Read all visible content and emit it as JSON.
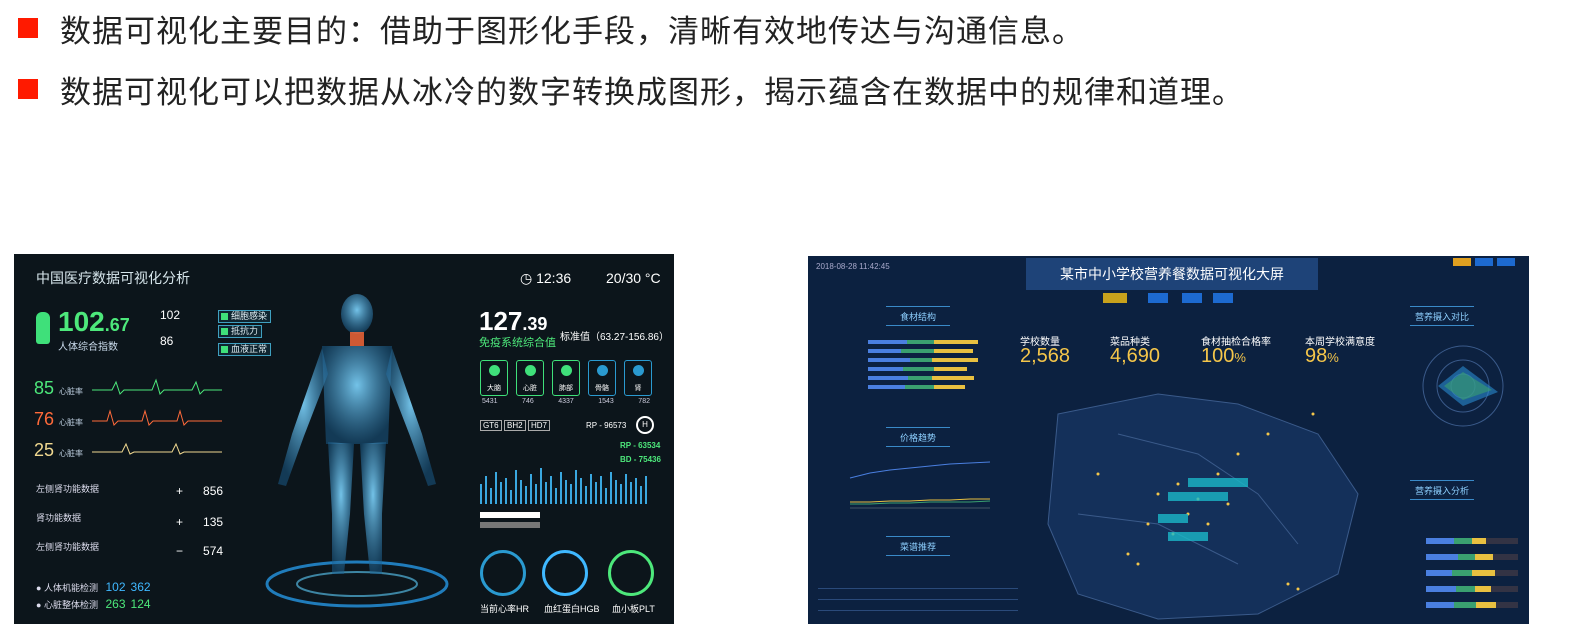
{
  "bullets": [
    "数据可视化主要目的：借助于图形化手段，清晰有效地传达与沟通信息。",
    "数据可视化可以把数据从冰冷的数字转换成图形，揭示蕴含在数据中的规律和道理。"
  ],
  "colors": {
    "bullet": "#ff1a00",
    "medical_bg": "#0c151b",
    "school_bg": "#0c2140",
    "green": "#4de87b",
    "gold": "#f5c64a"
  },
  "medical": {
    "title": "中国医疗数据可视化分析",
    "time": "12:36",
    "temp": "20/30 °C",
    "index_int": "102",
    "index_dec": ".67",
    "index_label": "人体综合指数",
    "side1": "102",
    "side2": "86",
    "tags": [
      "细胞感染",
      "抵抗力",
      "血液正常"
    ],
    "vitals": [
      {
        "value": "85",
        "label": "心脏率",
        "color": "#4de87b"
      },
      {
        "value": "76",
        "label": "心脏率",
        "color": "#ff6a3a"
      },
      {
        "value": "25",
        "label": "心脏率",
        "color": "#f0d890"
      }
    ],
    "metrics": [
      {
        "label": "左侧肾功能数据",
        "sign": "+",
        "value": "856"
      },
      {
        "label": "肾功能数据",
        "sign": "+",
        "value": "135"
      },
      {
        "label": "左侧肾功能数据",
        "sign": "−",
        "value": "574"
      }
    ],
    "bottom": [
      {
        "label": "人体机能检测",
        "value": "102",
        "value2": "362"
      },
      {
        "label": "心脏整体检测",
        "value": "263",
        "value2": "124"
      }
    ],
    "immune_int": "127",
    "immune_dec": ".39",
    "immune_label": "免疫系统综合值",
    "standard": "标准值（63.27-156.86）",
    "gboxes": [
      "大脑",
      "心脏",
      "肺部",
      "骨骼",
      "肾"
    ],
    "gbox_values": [
      "5431",
      "746",
      "4337",
      "1543",
      "782"
    ],
    "hormones": [
      "GT6",
      "BH2",
      "HD7"
    ],
    "rp": "RP - 96573",
    "rp2": "RP - 63534",
    "bd": "BD - 75436",
    "rings": [
      "当前心率HR",
      "血红蛋白HGB",
      "血小板PLT"
    ]
  },
  "school": {
    "timestamp": "2018-08-28 11:42:45",
    "title": "某市中小学校营养餐数据可视化大屏",
    "panels": [
      "食材结构",
      "价格趋势",
      "菜谱推荐",
      "营养摄入对比",
      "营养摄入分析"
    ],
    "kpis": [
      {
        "label": "学校数量",
        "value": "2,568",
        "unit": ""
      },
      {
        "label": "菜品种类",
        "value": "4,690",
        "unit": ""
      },
      {
        "label": "食材抽检合格率",
        "value": "100",
        "unit": "%"
      },
      {
        "label": "本周学校满意度",
        "value": "98",
        "unit": "%"
      }
    ]
  }
}
